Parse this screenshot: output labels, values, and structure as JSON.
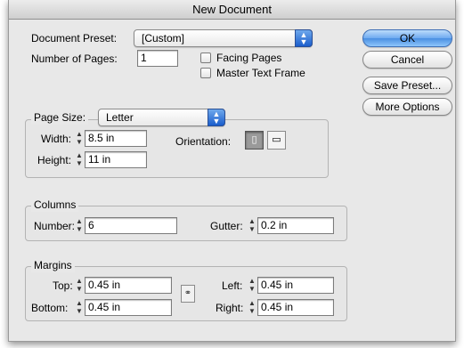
{
  "window": {
    "title": "New Document"
  },
  "preset": {
    "label": "Document Preset:",
    "value": "[Custom]"
  },
  "pages": {
    "label": "Number of Pages:",
    "value": "1"
  },
  "options": {
    "facing_pages": "Facing Pages",
    "master_text_frame": "Master Text Frame"
  },
  "page_size": {
    "label": "Page Size:",
    "value": "Letter",
    "width_label": "Width:",
    "width_value": "8.5 in",
    "height_label": "Height:",
    "height_value": "11 in",
    "orientation_label": "Orientation:"
  },
  "columns": {
    "title": "Columns",
    "number_label": "Number:",
    "number_value": "6",
    "gutter_label": "Gutter:",
    "gutter_value": "0.2 in"
  },
  "margins": {
    "title": "Margins",
    "top_label": "Top:",
    "top_value": "0.45 in",
    "bottom_label": "Bottom:",
    "bottom_value": "0.45 in",
    "left_label": "Left:",
    "left_value": "0.45 in",
    "right_label": "Right:",
    "right_value": "0.45 in"
  },
  "buttons": {
    "ok": "OK",
    "cancel": "Cancel",
    "save_preset": "Save Preset...",
    "more_options": "More Options"
  },
  "icons": {
    "popup_arrows": "up-down-arrows-icon",
    "stepper": "stepper-icon",
    "portrait": "portrait-orientation-icon",
    "landscape": "landscape-orientation-icon",
    "chain": "chain-link-icon"
  },
  "colors": {
    "default_button": "#6eaaf0",
    "popup_arrows": "#1a5dcc",
    "dialog_bg": "#e8e8e8"
  }
}
